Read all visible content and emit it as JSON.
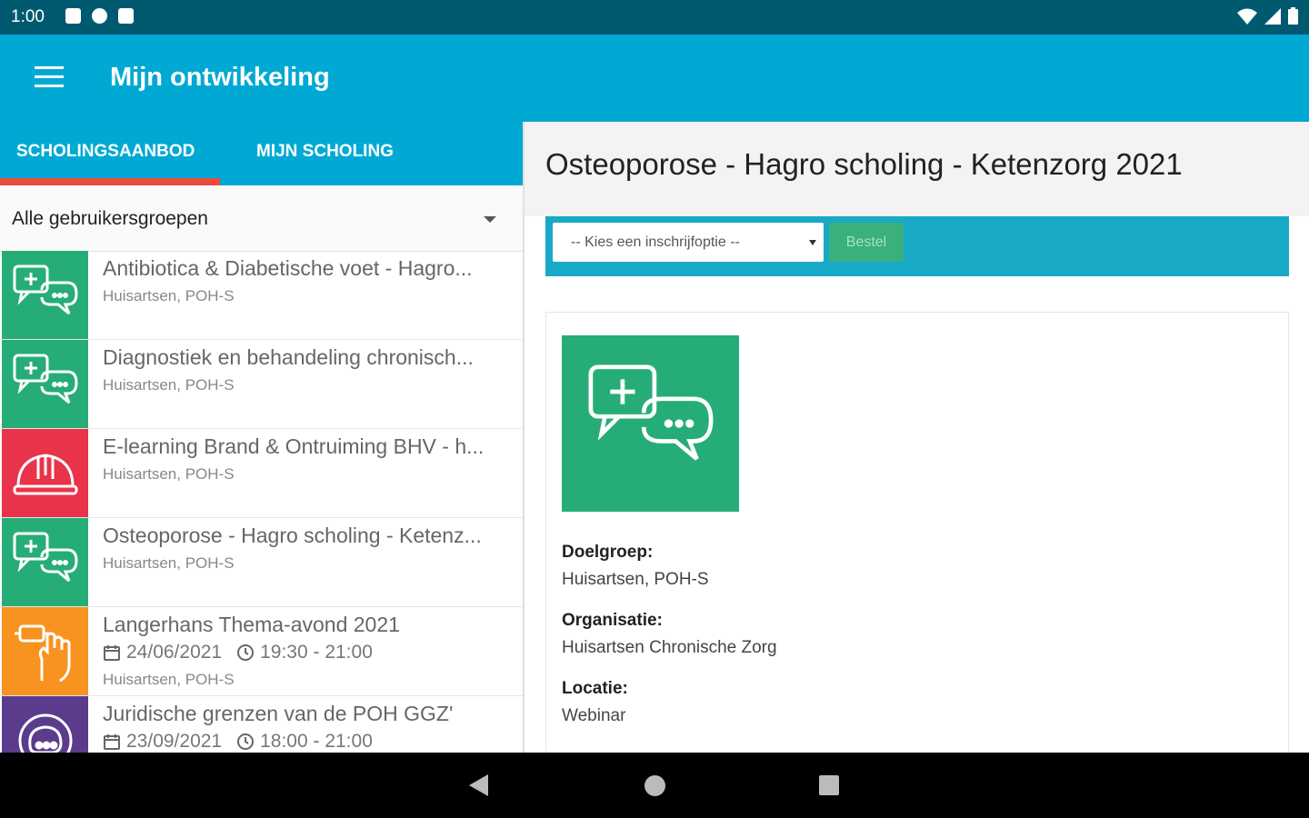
{
  "status_bar": {
    "time": "1:00"
  },
  "app_bar": {
    "title": "Mijn ontwikkeling",
    "menu_icon": "hamburger-menu-icon",
    "color": "#00a9d4"
  },
  "tabs": [
    {
      "label": "SCHOLINGSAANBOD",
      "selected": true
    },
    {
      "label": "MIJN SCHOLING",
      "selected": false
    }
  ],
  "filter": {
    "selected": "Alle gebruikersgroepen"
  },
  "list": {
    "items": [
      {
        "title": "Antibiotica & Diabetische voet  - Hagro...",
        "audience": "Huisartsen, POH-S",
        "icon": "medical-chat-icon",
        "color": "#26ad77"
      },
      {
        "title": "Diagnostiek en behandeling chronisch...",
        "audience": "Huisartsen, POH-S",
        "icon": "medical-chat-icon",
        "color": "#26ad77"
      },
      {
        "title": "E-learning Brand & Ontruiming BHV - h...",
        "audience": "Huisartsen, POH-S",
        "icon": "hard-hat-icon",
        "color": "#e8334a"
      },
      {
        "title": "Osteoporose - Hagro scholing - Ketenz...",
        "audience": "Huisartsen, POH-S",
        "icon": "medical-chat-icon",
        "color": "#26ad77"
      },
      {
        "title": "Langerhans Thema-avond 2021",
        "date": "24/06/2021",
        "time": "19:30 - 21:00",
        "audience": "Huisartsen, POH-S",
        "icon": "hand-hygiene-icon",
        "color": "#f7931e"
      },
      {
        "title": "Juridische grenzen van de POH GGZ'",
        "date": "23/09/2021",
        "time": "18:00 - 21:00",
        "audience": "",
        "icon": "brain-head-icon",
        "color": "#5b3c8c"
      }
    ]
  },
  "detail": {
    "title": "Osteoporose - Hagro scholing - Ketenzorg 2021",
    "order_select_placeholder": "-- Kies een inschrijfoptie --",
    "order_button": "Bestel",
    "doelgroep_label": "Doelgroep:",
    "doelgroep_value": "Huisartsen, POH-S",
    "organisatie_label": "Organisatie:",
    "organisatie_value": "Huisartsen Chronische Zorg",
    "locatie_label": "Locatie:",
    "locatie_value": "Webinar"
  }
}
